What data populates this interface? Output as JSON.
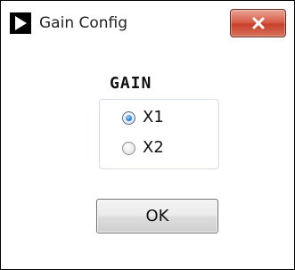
{
  "window": {
    "title": "Gain Config"
  },
  "icons": {
    "app": "play-icon",
    "close": "close-icon"
  },
  "gain": {
    "label": "GAIN",
    "options": [
      {
        "label": "X1",
        "selected": true
      },
      {
        "label": "X2",
        "selected": false
      }
    ]
  },
  "buttons": {
    "ok_label": "OK"
  },
  "colors": {
    "close_button": "#d9604b",
    "radio_selected": "#2d7fd6"
  }
}
